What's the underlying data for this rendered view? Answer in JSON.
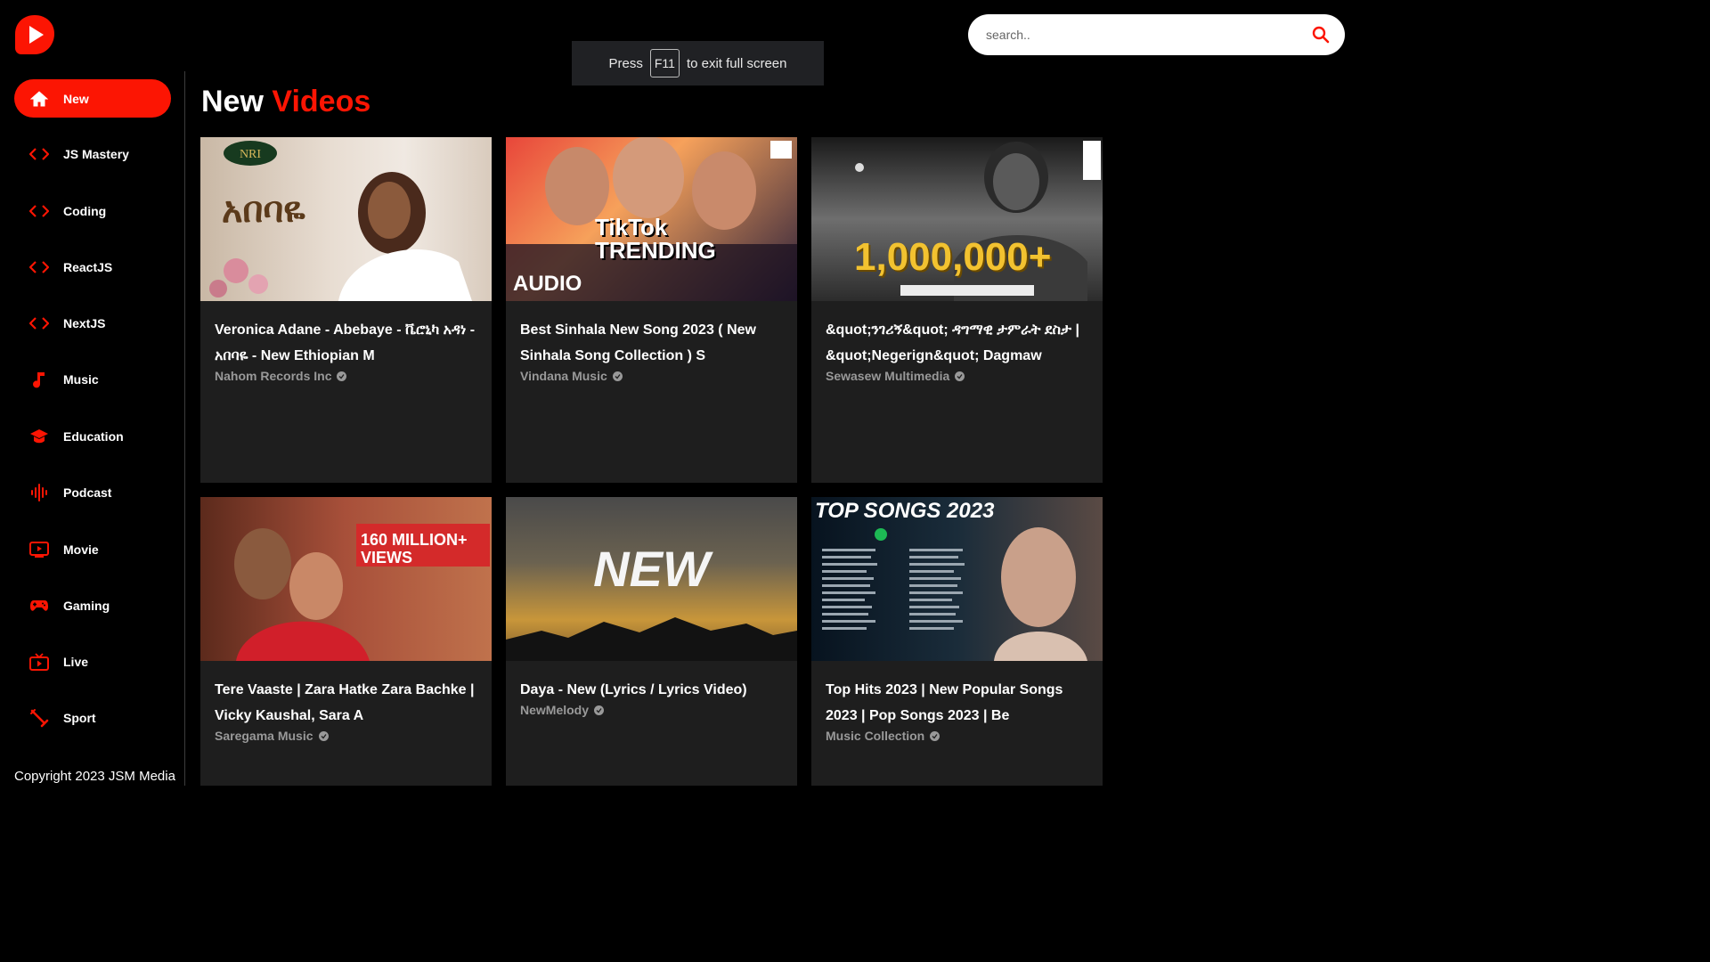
{
  "search": {
    "placeholder": "search.."
  },
  "fullscreen_toast": {
    "press": "Press",
    "key": "F11",
    "suffix": "to exit full screen"
  },
  "sidebar": {
    "items": [
      {
        "label": "New",
        "icon": "home-icon",
        "active": true
      },
      {
        "label": "JS Mastery",
        "icon": "code-icon"
      },
      {
        "label": "Coding",
        "icon": "code-icon"
      },
      {
        "label": "ReactJS",
        "icon": "code-icon"
      },
      {
        "label": "NextJS",
        "icon": "code-icon"
      },
      {
        "label": "Music",
        "icon": "music-note-icon"
      },
      {
        "label": "Education",
        "icon": "graduation-cap-icon"
      },
      {
        "label": "Podcast",
        "icon": "sound-wave-icon"
      },
      {
        "label": "Movie",
        "icon": "movie-icon"
      },
      {
        "label": "Gaming",
        "icon": "gamepad-icon"
      },
      {
        "label": "Live",
        "icon": "live-tv-icon"
      },
      {
        "label": "Sport",
        "icon": "sport-icon"
      }
    ],
    "copyright": "Copyright 2023 JSM Media"
  },
  "main": {
    "title_first": "New",
    "title_second": "Videos",
    "videos": [
      {
        "title": "Veronica Adane - Abebaye - ቬሮኒካ አዳነ - አበባዬ - New Ethiopian M",
        "channel": "Nahom Records Inc",
        "thumb_text": "አበባዬ"
      },
      {
        "title": "Best Sinhala New Song 2023 ( New Sinhala Song Collection ) S",
        "channel": "Vindana Music",
        "thumb_text": "TikTok TRENDING"
      },
      {
        "title": "&quot;ንገሪኝ&quot; ዳግማዊ ታምራት ደስታ | &quot;Negerign&quot; Dagmaw",
        "channel": "Sewasew Multimedia",
        "thumb_text": "1,000,000+"
      },
      {
        "title": "Tere Vaaste | Zara Hatke Zara Bachke | Vicky Kaushal, Sara A",
        "channel": "Saregama Music",
        "thumb_text": "160 MILLION+ VIEWS"
      },
      {
        "title": "Daya - New (Lyrics / Lyrics Video)",
        "channel": "NewMelody",
        "thumb_text": "NEW"
      },
      {
        "title": "Top Hits 2023 | New Popular Songs 2023 | Pop Songs 2023 | Be",
        "channel": "Music Collection",
        "thumb_text": "TOP SONGS 2023"
      }
    ]
  },
  "colors": {
    "accent": "#fc1503",
    "card_bg": "#1e1e1e",
    "channel_text": "#999999"
  }
}
